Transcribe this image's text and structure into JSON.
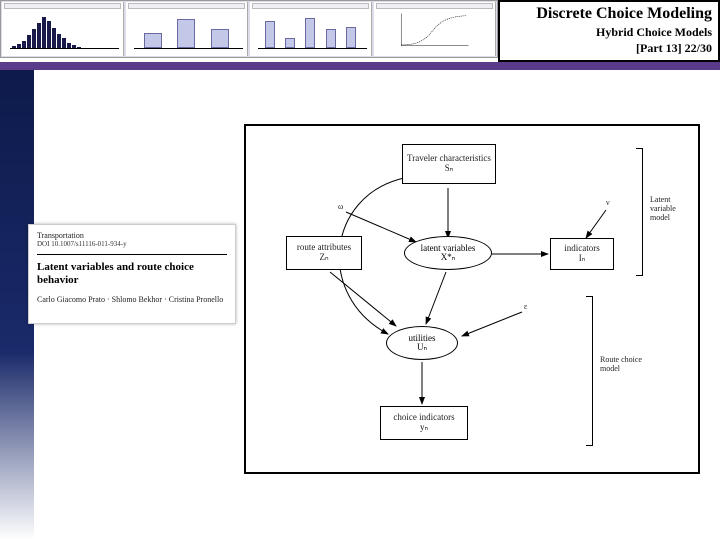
{
  "header": {
    "title_main": "Discrete Choice Modeling",
    "title_sub": "Hybrid Choice Models",
    "part_label": "[Part  13]   22/30",
    "thumbs": {
      "t1_title": "",
      "t2_title": "",
      "t3_title": "",
      "t4_title": ""
    }
  },
  "paper": {
    "journal": "Transportation",
    "doi": "DOI 10.1007/s11116-011-934-y",
    "title": "Latent variables and route choice behavior",
    "authors": "Carlo Giacomo Prato · Shlomo Bekhor · Cristina Pronello"
  },
  "diagram": {
    "traveler": {
      "line1": "Traveler characteristics",
      "line2": "Sₙ"
    },
    "route": {
      "line1": "route attributes",
      "line2": "Zₙ"
    },
    "latent": {
      "line1": "latent variables",
      "line2": "X*ₙ"
    },
    "indicators": {
      "line1": "indicators",
      "line2": "Iₙ"
    },
    "utilities": {
      "line1": "utilities",
      "line2": "Uₙ"
    },
    "choice": {
      "line1": "choice indicators",
      "line2": "yₙ"
    },
    "labels": {
      "omega": "ω",
      "nu": "ν",
      "epsilon": "ε",
      "lvm": "Latent variable model",
      "rcm": "Route choice model"
    }
  }
}
